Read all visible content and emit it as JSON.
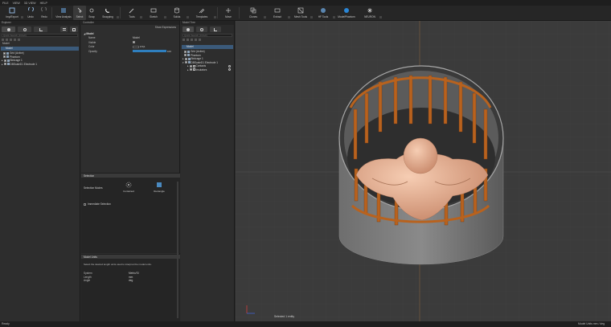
{
  "menu": [
    "FILE",
    "VIEW",
    "3D VIEW",
    "HELP"
  ],
  "toolbar": {
    "buttons": [
      {
        "label": "Imp/Export",
        "icon": "import-export-icon"
      },
      {
        "label": "Undo",
        "icon": "undo-icon"
      },
      {
        "label": "Redo",
        "icon": "redo-icon"
      },
      {
        "label": "View Analysis",
        "icon": "view-analysis-icon"
      },
      {
        "label": "Select",
        "icon": "select-icon"
      },
      {
        "label": "Snap",
        "icon": "snap-icon"
      },
      {
        "label": "Snapping",
        "icon": "snapping-icon"
      },
      {
        "label": "Tools",
        "icon": "tools-icon"
      },
      {
        "label": "Sketch",
        "icon": "sketch-icon"
      },
      {
        "label": "Solids",
        "icon": "solids-icon"
      },
      {
        "label": "Templates",
        "icon": "templates-icon"
      },
      {
        "label": "Move",
        "icon": "move-icon"
      },
      {
        "label": "Clones",
        "icon": "clones-icon"
      },
      {
        "label": "Extract",
        "icon": "extract-icon"
      },
      {
        "label": "Mesh Tools",
        "icon": "mesh-tools-icon"
      },
      {
        "label": "HF Tools",
        "icon": "hf-tools-icon"
      },
      {
        "label": "ModelPhantom",
        "icon": "model-phantom-icon"
      },
      {
        "label": "NEURON",
        "icon": "neuron-icon"
      }
    ]
  },
  "explorer": {
    "title": "Explorer",
    "search_placeholder": "Quick Search (Ctrl+F)",
    "model_label": "Model",
    "root": "Model",
    "items": [
      "Grid (Active)",
      "Phantom",
      "Birdcage 1",
      "DBScaleD1 Electrode 1"
    ]
  },
  "controller": {
    "title": "Controller",
    "show_expressions": "Show Expressions",
    "section": "Model",
    "props": [
      {
        "key": "Name",
        "value": "Model"
      },
      {
        "key": "Visible",
        "value": ""
      },
      {
        "key": "Color",
        "value": "0.5|1"
      },
      {
        "key": "Opacity",
        "value": "100"
      }
    ],
    "opacity_fraction": 1.0,
    "selection": {
      "title": "Selection",
      "modes_label": "Selection Modes",
      "mode1": "Contained",
      "mode2": "Rectangle",
      "immediate": "Immediate Selection"
    },
    "units": {
      "title": "Model Units",
      "desc": "Select the desired length units used to interpret the model units.",
      "rows": [
        {
          "k": "System",
          "v": "Metric/SI"
        },
        {
          "k": "Length",
          "v": "mm"
        },
        {
          "k": "Angle",
          "v": "deg"
        }
      ]
    }
  },
  "model_tree": {
    "title": "Model Tree",
    "root": "Model",
    "items": [
      "Grid (Active)",
      "Phantom",
      "Birdcage 1",
      "DBScaleD1 Electrode 1",
      "Contacts",
      "Insulators"
    ]
  },
  "status": {
    "left": "Ready",
    "selected": "Selected 1 entity",
    "units": "Model Units mm / deg"
  },
  "colors": {
    "accent": "#3b5a7a",
    "rungs": "#b8621e",
    "skin": "#e4a88a",
    "cylinder": "#7b7b7b"
  }
}
